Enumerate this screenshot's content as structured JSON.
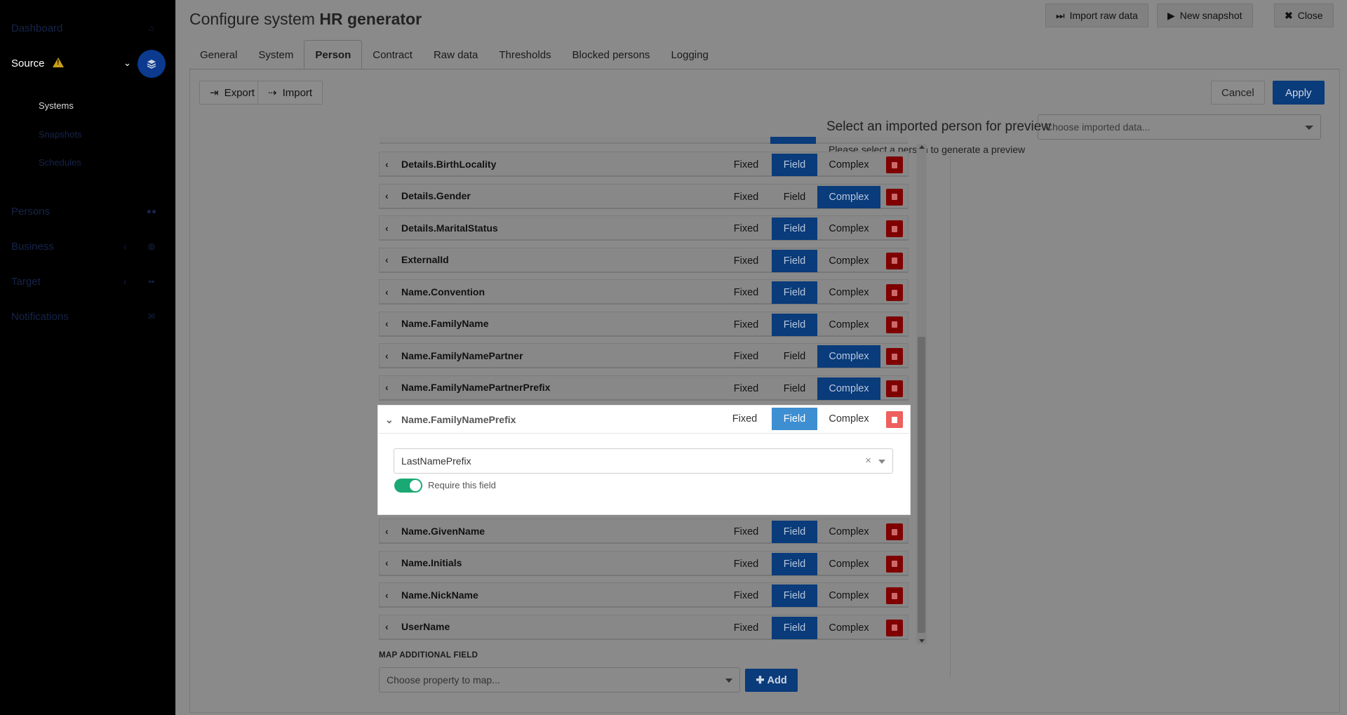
{
  "sidebar": {
    "items": [
      {
        "label": "Dashboard",
        "icon": "home-icon"
      },
      {
        "label": "Source",
        "icon": "layers-icon"
      },
      {
        "label": "Persons",
        "icon": "users-icon"
      },
      {
        "label": "Business",
        "icon": "globe-icon"
      },
      {
        "label": "Target",
        "icon": "grid-icon"
      },
      {
        "label": "Notifications",
        "icon": "envelope-icon"
      }
    ],
    "source_subitems": [
      "Systems",
      "Snapshots",
      "Schedules"
    ]
  },
  "header": {
    "title_prefix": "Configure system ",
    "title_bold": "HR generator",
    "buttons": [
      "Import raw data",
      "New snapshot",
      "Close"
    ]
  },
  "tabs": [
    "General",
    "System",
    "Person",
    "Contract",
    "Raw data",
    "Thresholds",
    "Blocked persons",
    "Logging"
  ],
  "active_tab": "Person",
  "toolbar": {
    "export_label": "Export",
    "import_label": "Import",
    "cancel_label": "Cancel",
    "apply_label": "Apply"
  },
  "preview": {
    "label": "Select an imported person for preview",
    "select_placeholder": "Choose imported data...",
    "message": "Please select a person to generate a preview"
  },
  "segment_labels": {
    "fixed": "Fixed",
    "field": "Field",
    "complex": "Complex"
  },
  "mappings_before": [
    {
      "name": "Details.BirthLocality",
      "mode": "Field"
    },
    {
      "name": "Details.Gender",
      "mode": "Complex"
    },
    {
      "name": "Details.MaritalStatus",
      "mode": "Field"
    },
    {
      "name": "ExternalId",
      "mode": "Field"
    },
    {
      "name": "Name.Convention",
      "mode": "Field"
    },
    {
      "name": "Name.FamilyName",
      "mode": "Field"
    },
    {
      "name": "Name.FamilyNamePartner",
      "mode": "Complex"
    },
    {
      "name": "Name.FamilyNamePartnerPrefix",
      "mode": "Complex"
    }
  ],
  "expanded_mapping": {
    "name": "Name.FamilyNamePrefix",
    "mode": "Field",
    "selected_field": "LastNamePrefix",
    "require_label": "Require this field",
    "require_enabled": true
  },
  "mappings_after": [
    {
      "name": "Name.GivenName",
      "mode": "Field"
    },
    {
      "name": "Name.Initials",
      "mode": "Field"
    },
    {
      "name": "Name.NickName",
      "mode": "Field"
    },
    {
      "name": "UserName",
      "mode": "Field"
    }
  ],
  "map_additional": {
    "label": "MAP ADDITIONAL FIELD",
    "placeholder": "Choose property to map...",
    "add_label": "Add"
  }
}
